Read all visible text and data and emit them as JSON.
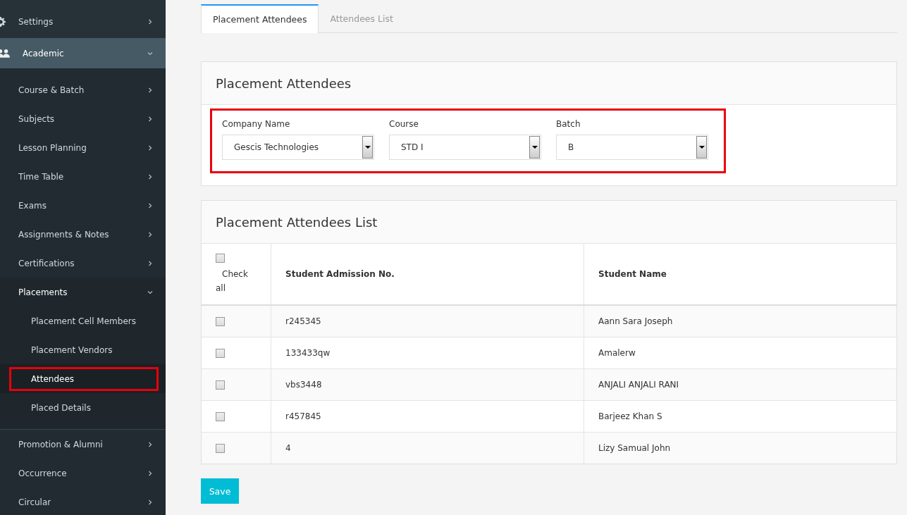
{
  "sidebar": {
    "items": [
      {
        "label": "Settings",
        "expanded": false
      },
      {
        "label": "Academic",
        "expanded": true,
        "children": [
          {
            "label": "Course & Batch",
            "expanded": false
          },
          {
            "label": "Subjects",
            "expanded": false
          },
          {
            "label": "Lesson Planning",
            "expanded": false
          },
          {
            "label": "Time Table",
            "expanded": false
          },
          {
            "label": "Exams",
            "expanded": false
          },
          {
            "label": "Assignments & Notes",
            "expanded": false
          },
          {
            "label": "Certifications",
            "expanded": false
          },
          {
            "label": "Placements",
            "expanded": true,
            "children": [
              {
                "label": "Placement Cell Members",
                "selected": false
              },
              {
                "label": "Placement Vendors",
                "selected": false
              },
              {
                "label": "Attendees",
                "selected": true
              },
              {
                "label": "Placed Details",
                "selected": false
              }
            ]
          },
          {
            "label": "Promotion & Alumni",
            "expanded": false
          },
          {
            "label": "Occurrence",
            "expanded": false
          },
          {
            "label": "Circular",
            "expanded": false
          }
        ]
      }
    ]
  },
  "tabs": [
    {
      "label": "Placement Attendees",
      "selected": true
    },
    {
      "label": "Attendees List",
      "selected": false
    }
  ],
  "filter_panel": {
    "title": "Placement Attendees",
    "highlighted": true,
    "fields": [
      {
        "label": "Company Name",
        "value": "Gescis Technologies"
      },
      {
        "label": "Course",
        "value": "STD I"
      },
      {
        "label": "Batch",
        "value": "B"
      }
    ]
  },
  "list_panel": {
    "title": "Placement Attendees List",
    "check_all": {
      "label": "Check all",
      "checked": false
    },
    "columns": [
      "Student Admission No.",
      "Student Name"
    ],
    "rows": [
      {
        "checked": false,
        "admission_no": "r245345",
        "name": "Aann Sara Joseph"
      },
      {
        "checked": false,
        "admission_no": "133433qw",
        "name": "Amalerw"
      },
      {
        "checked": false,
        "admission_no": "vbs3448",
        "name": "ANJALI ANJALI RANI"
      },
      {
        "checked": false,
        "admission_no": "r457845",
        "name": "Barjeez Khan S"
      },
      {
        "checked": false,
        "admission_no": "4",
        "name": "Lizy Samual John"
      }
    ]
  },
  "save_button": "Save"
}
